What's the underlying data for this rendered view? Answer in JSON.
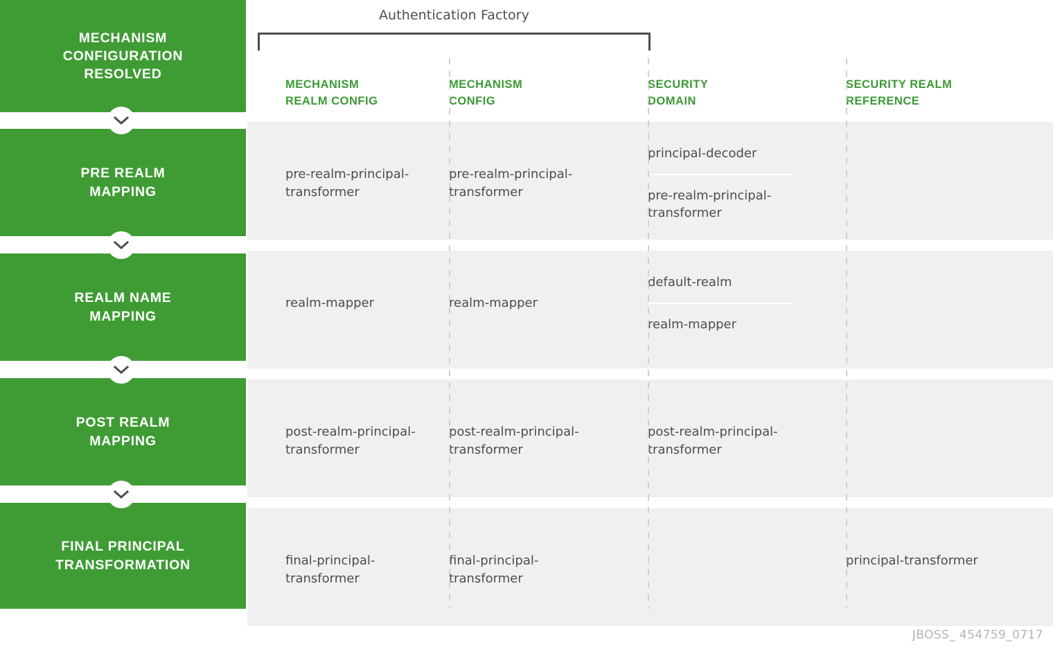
{
  "bracket": {
    "label": "Authentication Factory"
  },
  "colors": {
    "stage_green": "#3f9c35",
    "header_green": "#3c9a35",
    "cell_bg": "#f0f0f0",
    "text_gray": "#4d4d4d",
    "divider_gray": "#cfcfcf",
    "footer_gray": "#b5b5b5"
  },
  "columns": [
    {
      "id": "mechanism-realm-config",
      "label": "MECHANISM\nREALM CONFIG"
    },
    {
      "id": "mechanism-config",
      "label": "MECHANISM\nCONFIG"
    },
    {
      "id": "security-domain",
      "label": "SECURITY\nDOMAIN"
    },
    {
      "id": "security-realm-reference",
      "label": "SECURITY REALM\nREFERENCE"
    }
  ],
  "stages": [
    {
      "id": "mechanism-configuration-resolved",
      "label": "MECHANISM\nCONFIGURATION\nRESOLVED"
    },
    {
      "id": "pre-realm-mapping",
      "label": "PRE REALM\nMAPPING"
    },
    {
      "id": "realm-name-mapping",
      "label": "REALM NAME\nMAPPING"
    },
    {
      "id": "post-realm-mapping",
      "label": "POST REALM\nMAPPING"
    },
    {
      "id": "final-principal-transformation",
      "label": "FINAL PRINCIPAL\nTRANSFORMATION"
    }
  ],
  "rows": [
    {
      "id": "pre-realm-mapping",
      "cells": [
        {
          "col": "mechanism-realm-config",
          "items": [
            "pre-realm-principal-\ntransformer"
          ]
        },
        {
          "col": "mechanism-config",
          "items": [
            "pre-realm-principal-\ntransformer"
          ]
        },
        {
          "col": "security-domain",
          "items": [
            "principal-decoder",
            "pre-realm-principal-\ntransformer"
          ]
        },
        {
          "col": "security-realm-reference",
          "items": []
        }
      ]
    },
    {
      "id": "realm-name-mapping",
      "cells": [
        {
          "col": "mechanism-realm-config",
          "items": [
            "realm-mapper"
          ]
        },
        {
          "col": "mechanism-config",
          "items": [
            "realm-mapper"
          ]
        },
        {
          "col": "security-domain",
          "items": [
            "default-realm",
            "realm-mapper"
          ]
        },
        {
          "col": "security-realm-reference",
          "items": []
        }
      ]
    },
    {
      "id": "post-realm-mapping",
      "cells": [
        {
          "col": "mechanism-realm-config",
          "items": [
            "post-realm-principal-\ntransformer"
          ]
        },
        {
          "col": "mechanism-config",
          "items": [
            "post-realm-principal-\ntransformer"
          ]
        },
        {
          "col": "security-domain",
          "items": [
            "post-realm-principal-\ntransformer"
          ]
        },
        {
          "col": "security-realm-reference",
          "items": []
        }
      ]
    },
    {
      "id": "final-principal-transformation",
      "cells": [
        {
          "col": "mechanism-realm-config",
          "items": [
            "final-principal-\ntransformer"
          ]
        },
        {
          "col": "mechanism-config",
          "items": [
            "final-principal-\ntransformer"
          ]
        },
        {
          "col": "security-domain",
          "items": []
        },
        {
          "col": "security-realm-reference",
          "items": [
            "principal-transformer"
          ]
        }
      ]
    }
  ],
  "footer": {
    "code": "JBOSS_ 454759_0717"
  }
}
